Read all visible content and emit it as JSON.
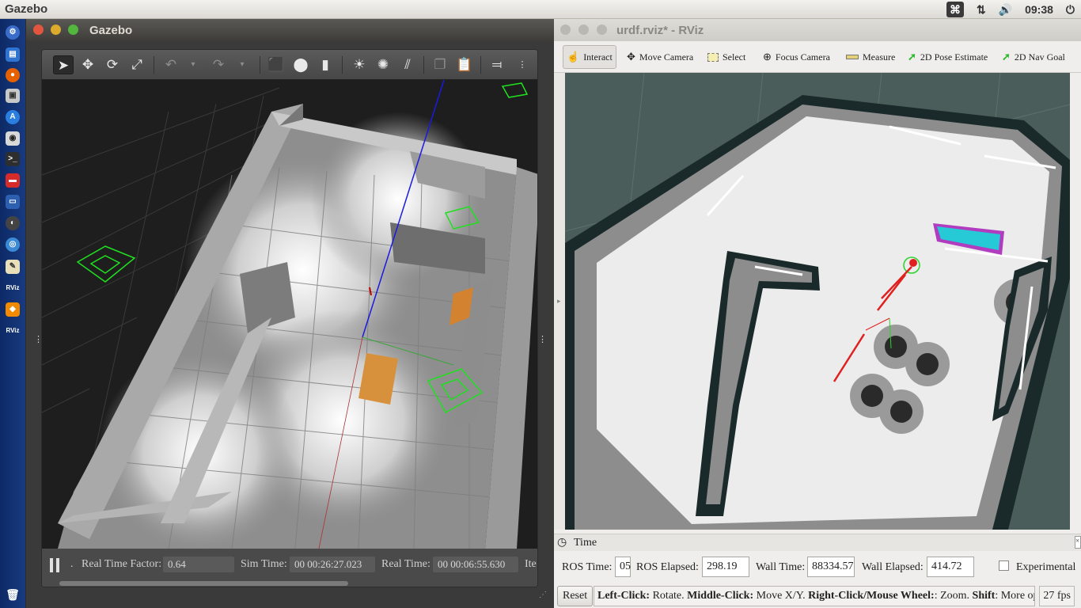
{
  "top_panel": {
    "app_title": "Gazebo",
    "clock": "09:38"
  },
  "launcher": {
    "items": [
      "settings",
      "files",
      "firefox",
      "archive",
      "software",
      "system",
      "terminal",
      "presentation",
      "monitor",
      "compass",
      "chromium",
      "notes",
      "rviz-1",
      "blender",
      "rviz-2",
      "trash"
    ],
    "rviz_label": "RViz"
  },
  "gazebo": {
    "title": "Gazebo",
    "toolbar": [
      "select",
      "translate",
      "rotate",
      "scale",
      "undo",
      "redo",
      "box",
      "sphere",
      "cylinder",
      "point-light",
      "spot-light",
      "directional-light",
      "copy",
      "paste",
      "align"
    ],
    "bottom": {
      "rtf_label": "Real Time Factor:",
      "rtf_value": "0.64",
      "sim_label": "Sim Time:",
      "sim_value": "00 00:26:27.023",
      "real_label": "Real Time:",
      "real_value": "00 00:06:55.630",
      "iter_label": "Ite"
    }
  },
  "rviz": {
    "title": "urdf.rviz* - RViz",
    "tools": {
      "interact": "Interact",
      "move_camera": "Move Camera",
      "select": "Select",
      "focus_camera": "Focus Camera",
      "measure": "Measure",
      "pose_estimate": "2D Pose Estimate",
      "nav_goal": "2D Nav Goal"
    },
    "time_panel": {
      "header": "Time",
      "ros_time_label": "ROS Time:",
      "ros_time_value": "05",
      "ros_elapsed_label": "ROS Elapsed:",
      "ros_elapsed_value": "298.19",
      "wall_time_label": "Wall Time:",
      "wall_time_value": "88334.57",
      "wall_elapsed_label": "Wall Elapsed:",
      "wall_elapsed_value": "414.72",
      "experimental_label": "Experimental"
    },
    "status": {
      "reset_label": "Reset",
      "left_click": "Left-Click:",
      "left_desc": " Rotate. ",
      "middle_click": "Middle-Click:",
      "middle_desc": " Move X/Y. ",
      "right_click": "Right-Click/Mouse Wheel:",
      "right_desc": ": Zoom. ",
      "shift": "Shift",
      "shift_desc": ": More opti",
      "fps": "27 fps"
    }
  }
}
